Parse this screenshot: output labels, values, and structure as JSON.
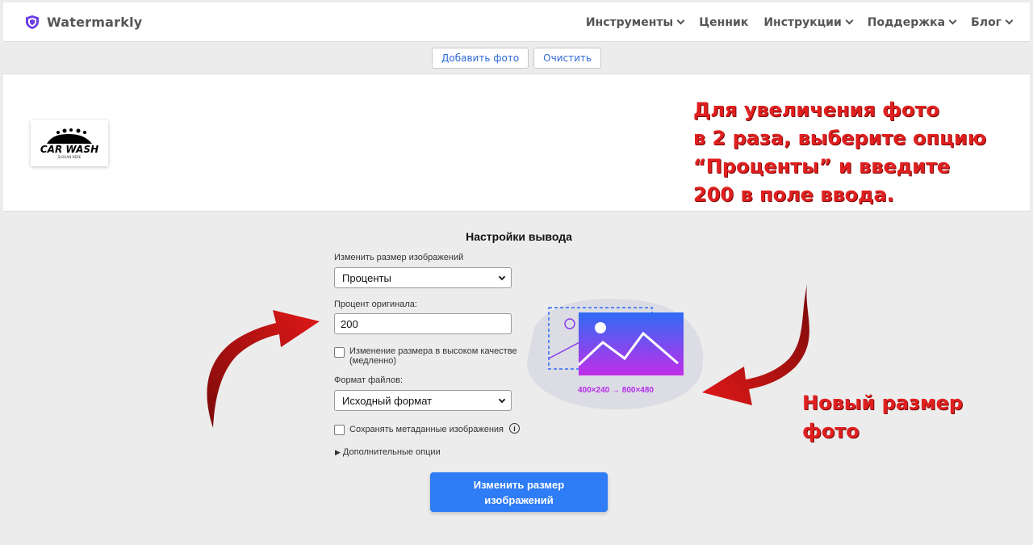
{
  "header": {
    "brand": "Watermarkly",
    "nav": [
      {
        "label": "Инструменты",
        "dropdown": true
      },
      {
        "label": "Ценник",
        "dropdown": false
      },
      {
        "label": "Инструкции",
        "dropdown": true
      },
      {
        "label": "Поддержка",
        "dropdown": true
      },
      {
        "label": "Блог",
        "dropdown": true
      }
    ]
  },
  "toolbar": {
    "add_photo": "Добавить фото",
    "clear": "Очистить"
  },
  "thumbnail": {
    "logo_text": "CAR WASH",
    "logo_subtext": "SLOGAN HERE"
  },
  "annotations": {
    "top": [
      "Для увеличения фото",
      "в 2 раза, выберите опцию",
      "“Проценты” и введите",
      "200 в поле ввода."
    ],
    "bottom": [
      "Новый размер",
      "фото"
    ],
    "color": "#e02020"
  },
  "settings": {
    "title": "Настройки вывода",
    "resize_label": "Изменить размер изображений",
    "resize_value": "Проценты",
    "percent_label": "Процент оригинала:",
    "percent_value": "200",
    "hq_label_1": "Изменение размера в высоком качестве",
    "hq_label_2": "(медленно)",
    "format_label": "Формат файлов:",
    "format_value": "Исходный формат",
    "metadata_label": "Сохранять метаданные изображения",
    "more_options": "Дополнительные опции",
    "submit_line1": "Изменить размер",
    "submit_line2": "изображений",
    "accent": "#2e7cf6"
  },
  "illustration": {
    "caption": "400×240 → 800×480"
  }
}
